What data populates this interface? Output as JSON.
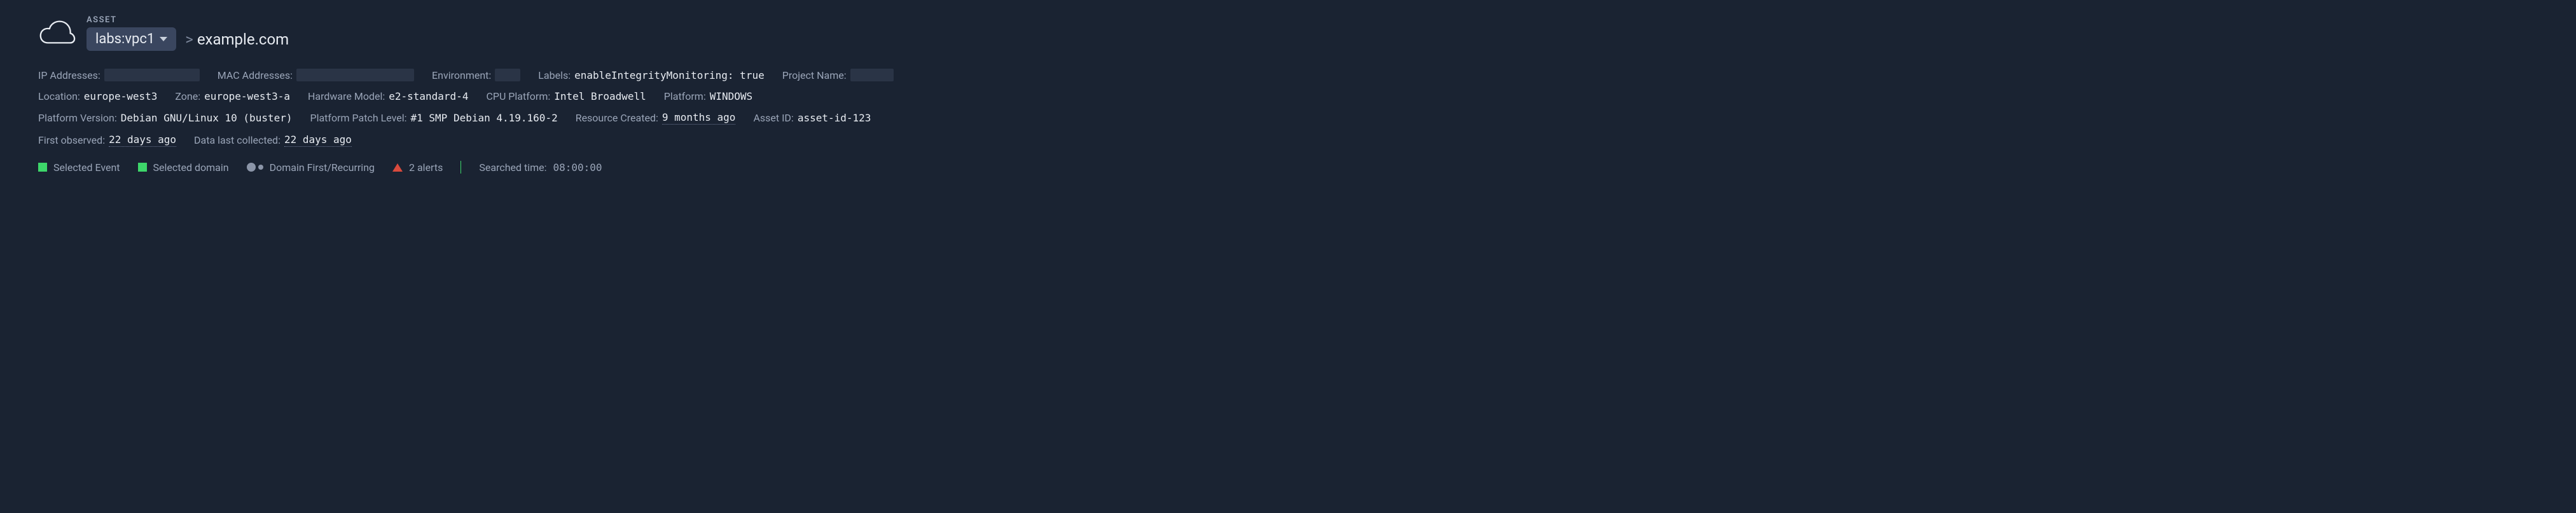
{
  "header": {
    "asset_label": "ASSET",
    "asset_selector": "labs:vpc1",
    "breadcrumb_sep": ">",
    "breadcrumb_domain": "example.com"
  },
  "meta": {
    "ip_label": "IP Addresses:",
    "mac_label": "MAC Addresses:",
    "env_label": "Environment:",
    "labels_label": "Labels:",
    "labels_value": "enableIntegrityMonitoring: true",
    "project_label": "Project Name:",
    "location_label": "Location:",
    "location_value": "europe-west3",
    "zone_label": "Zone:",
    "zone_value": "europe-west3-a",
    "hw_label": "Hardware Model:",
    "hw_value": "e2-standard-4",
    "cpu_label": "CPU Platform:",
    "cpu_value": "Intel Broadwell",
    "platform_label": "Platform:",
    "platform_value": "WINDOWS",
    "pver_label": "Platform Version:",
    "pver_value": "Debian GNU/Linux 10 (buster)",
    "ppatch_label": "Platform Patch Level:",
    "ppatch_value": "#1 SMP Debian 4.19.160-2",
    "rcreated_label": "Resource Created:",
    "rcreated_value": "9 months ago",
    "assetid_label": "Asset ID:",
    "assetid_value": "asset-id-123",
    "firstobs_label": "First observed:",
    "firstobs_value": "22 days ago",
    "lastcol_label": "Data last collected:",
    "lastcol_value": "22 days ago"
  },
  "legend": {
    "selected_event": "Selected Event",
    "selected_domain": "Selected domain",
    "domain_fr": "Domain First/Recurring",
    "alerts": "2 alerts",
    "searched_time_label": "Searched time:",
    "searched_time_value": "08:00:00"
  }
}
